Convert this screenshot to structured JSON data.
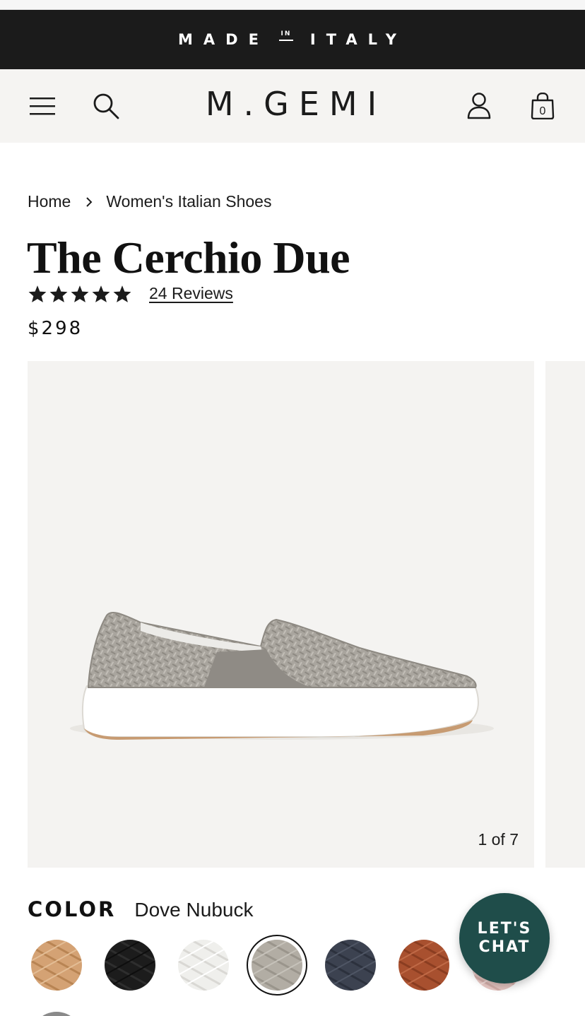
{
  "promo": {
    "text_main_1": "MADE",
    "text_in": "IN",
    "text_main_2": "ITALY"
  },
  "header": {
    "logo": "M.GEMI",
    "bag_count": "0"
  },
  "breadcrumb": {
    "home": "Home",
    "category": "Women's Italian Shoes"
  },
  "product": {
    "title": "The Cerchio Due",
    "rating": 5,
    "reviews_label": "24 Reviews",
    "price": "$298"
  },
  "gallery": {
    "counter": "1 of 7"
  },
  "color": {
    "label": "COLOR",
    "selected_name": "Dove Nubuck",
    "swatches": [
      {
        "name": "tan",
        "color": "#d4a274"
      },
      {
        "name": "black",
        "color": "#1c1c1c"
      },
      {
        "name": "white",
        "color": "#efefec"
      },
      {
        "name": "dove",
        "color": "#b2ada4",
        "selected": true
      },
      {
        "name": "navy",
        "color": "#3c4250"
      },
      {
        "name": "cognac",
        "color": "#a8502f"
      },
      {
        "name": "blush",
        "color": "#e8c8c4"
      }
    ]
  },
  "chat": {
    "label": "LET'S CHAT"
  },
  "colors": {
    "promo_bg": "#1b1b1b",
    "header_bg": "#f5f4f2",
    "chat_bg": "#1f4d4a",
    "gallery_bg": "#f4f3f1"
  }
}
